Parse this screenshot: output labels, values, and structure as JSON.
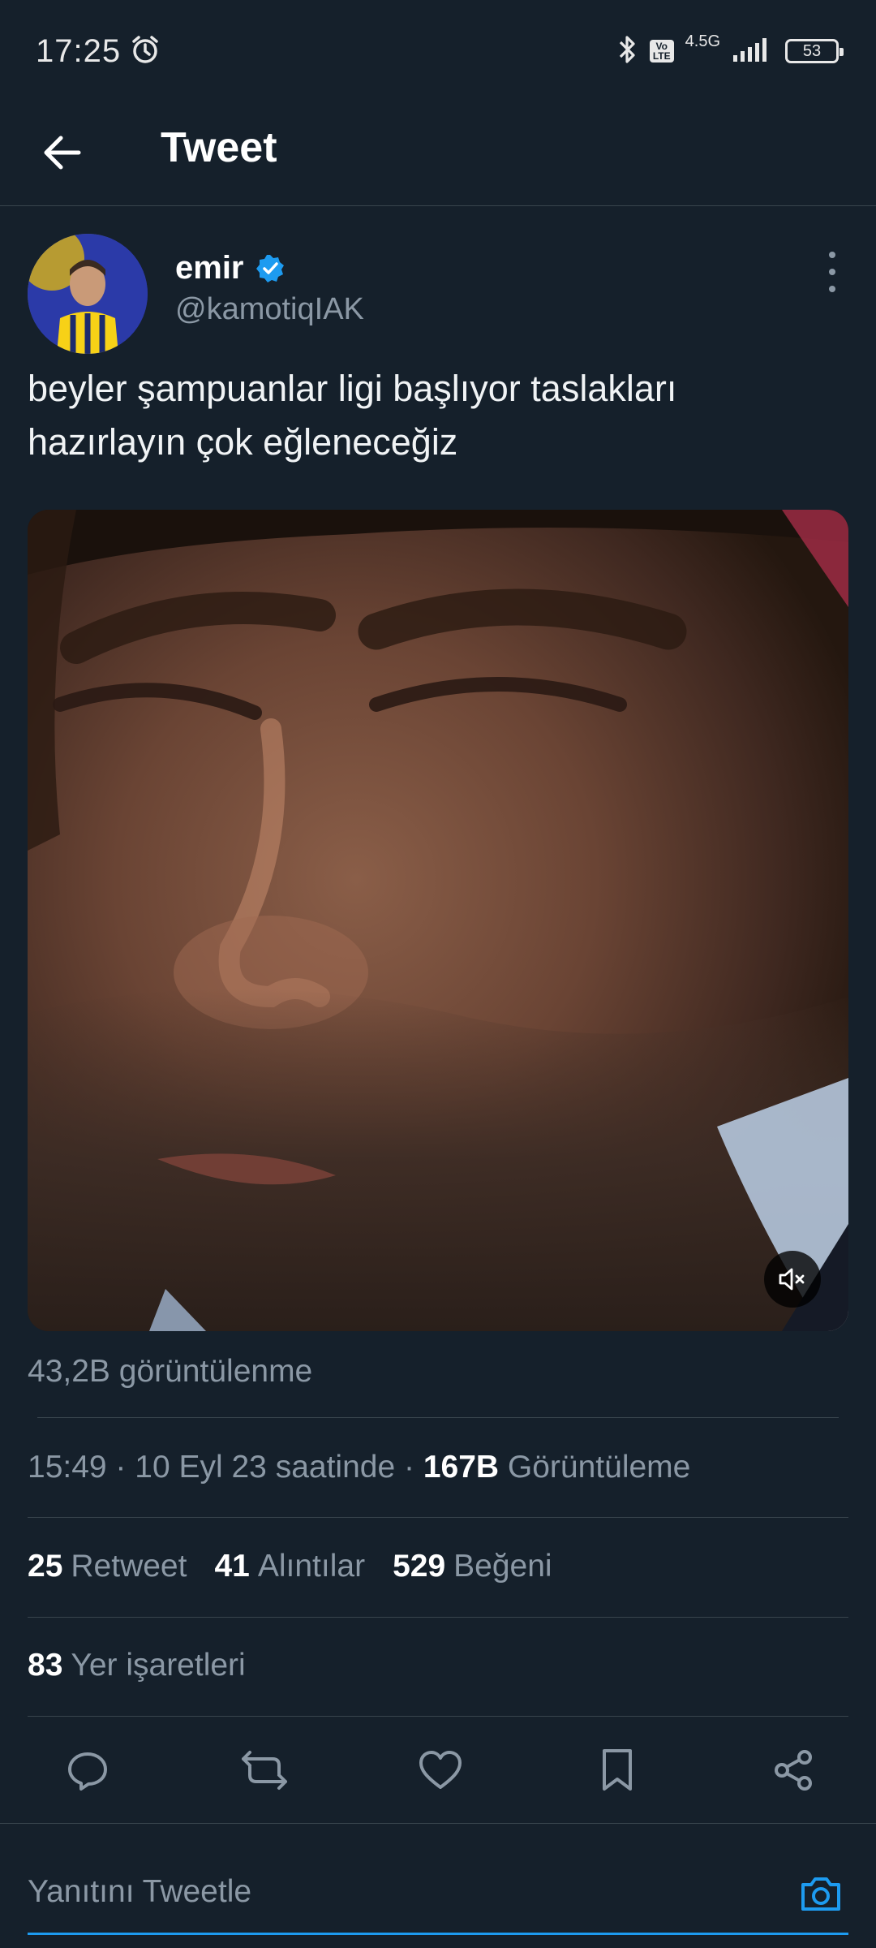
{
  "status_bar": {
    "time": "17:25",
    "network": "4.5G",
    "battery": "53"
  },
  "header": {
    "title": "Tweet"
  },
  "tweet": {
    "author": {
      "display_name": "emir",
      "handle": "@kamotiqIAK"
    },
    "text_line1": "beyler şampuanlar ligi başlıyor taslakları",
    "text_line2": "hazırlayın çok eğleneceğiz",
    "media_views": "43,2B görüntülenme",
    "time": "15:49 · 10 Eyl 23 saatinde ·",
    "view_count": "167B",
    "view_label": "Görüntüleme",
    "stats": [
      {
        "count": "25",
        "label": "Retweet"
      },
      {
        "count": "41",
        "label": "Alıntılar"
      },
      {
        "count": "529",
        "label": "Beğeni"
      }
    ],
    "bookmarks": {
      "count": "83",
      "label": "Yer işaretleri"
    }
  },
  "reply": {
    "placeholder": "Yanıtını Tweetle"
  },
  "colors": {
    "background": "#15202b",
    "accent": "#1d9bf0",
    "secondary_text": "#8b98a5",
    "divider": "#38444d"
  }
}
